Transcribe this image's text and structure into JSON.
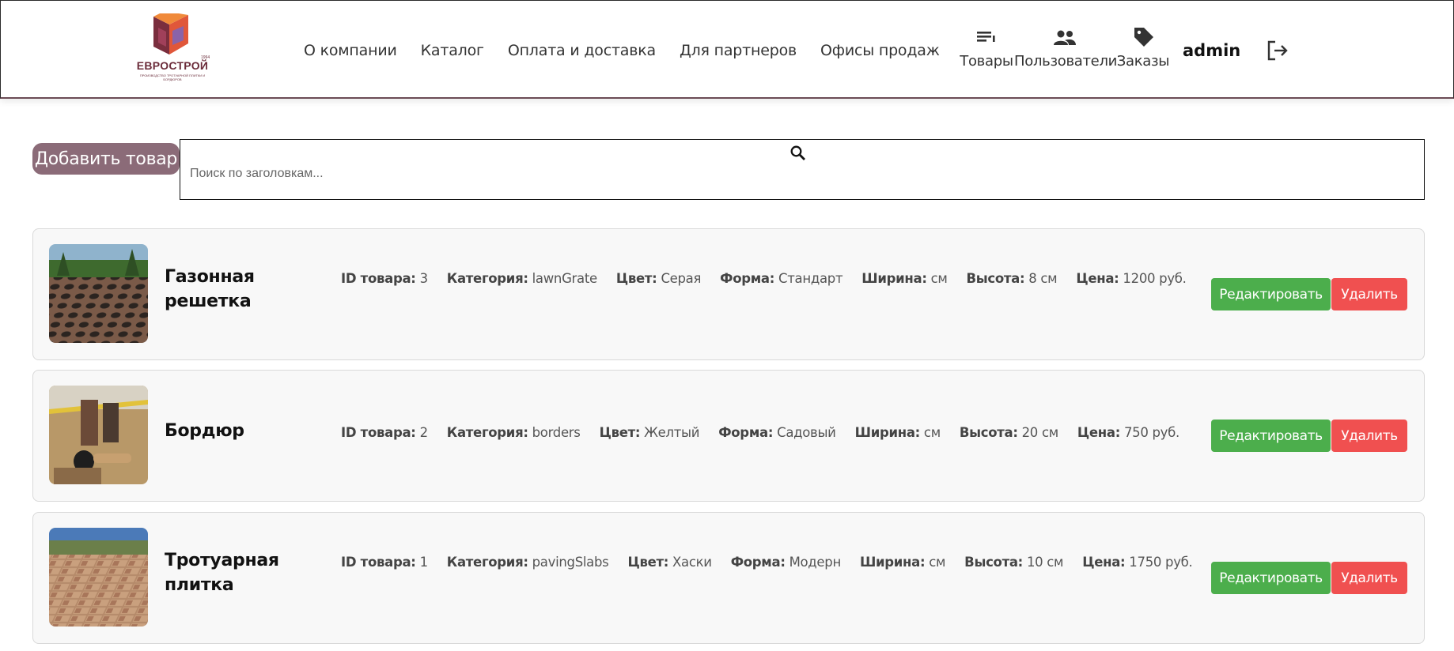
{
  "header": {
    "logo": {
      "name": "ЕВРОСТРОЙ",
      "tagline": "ПРОИЗВОДСТВО ТРОТУАРНОЙ ПЛИТКИ И БОРДЮРОВ",
      "year": "1994",
      "icon": "eurostroy-logo"
    },
    "nav": [
      {
        "label": "О компании"
      },
      {
        "label": "Каталог"
      },
      {
        "label": "Оплата и доставка"
      },
      {
        "label": "Для партнеров"
      },
      {
        "label": "Офисы продаж"
      }
    ],
    "admin_nav": [
      {
        "label": "Товары",
        "icon": "list-icon"
      },
      {
        "label": "Пользователи",
        "icon": "users-icon"
      },
      {
        "label": "Заказы",
        "icon": "tag-icon"
      }
    ],
    "username": "admin",
    "logout_icon": "logout-icon"
  },
  "toolbar": {
    "add_label": "Добавить товар",
    "search_placeholder": "Поиск по заголовкам...",
    "search_icon": "search-icon"
  },
  "colors": {
    "accent": "#8b6b78",
    "edit": "#4cae4c",
    "delete": "#f05050",
    "logo": "#6b2c3a"
  },
  "labels": {
    "id": "ID товара:",
    "category": "Категория:",
    "color": "Цвет:",
    "shape": "Форма:",
    "width": "Ширина:",
    "height": "Высота:",
    "price": "Цена:"
  },
  "products": [
    {
      "name": "Газонная решетка",
      "image": "lawn-grate-photo",
      "id": "3",
      "category": "lawnGrate",
      "color": "Серая",
      "shape": "Стандарт",
      "width": "см",
      "height": "8 см",
      "price": "1200 руб.",
      "edit_label": "Редактировать",
      "delete_label": "Удалить"
    },
    {
      "name": "Бордюр",
      "image": "border-photo",
      "id": "2",
      "category": "borders",
      "color": "Желтый",
      "shape": "Садовый",
      "width": "см",
      "height": "20 см",
      "price": "750 руб.",
      "edit_label": "Редактировать",
      "delete_label": "Удалить"
    },
    {
      "name": "Тротуарная плитка",
      "image": "paving-slabs-photo",
      "id": "1",
      "category": "pavingSlabs",
      "color": "Хаски",
      "shape": "Модерн",
      "width": "см",
      "height": "10 см",
      "price": "1750 руб.",
      "edit_label": "Редактировать",
      "delete_label": "Удалить"
    }
  ]
}
